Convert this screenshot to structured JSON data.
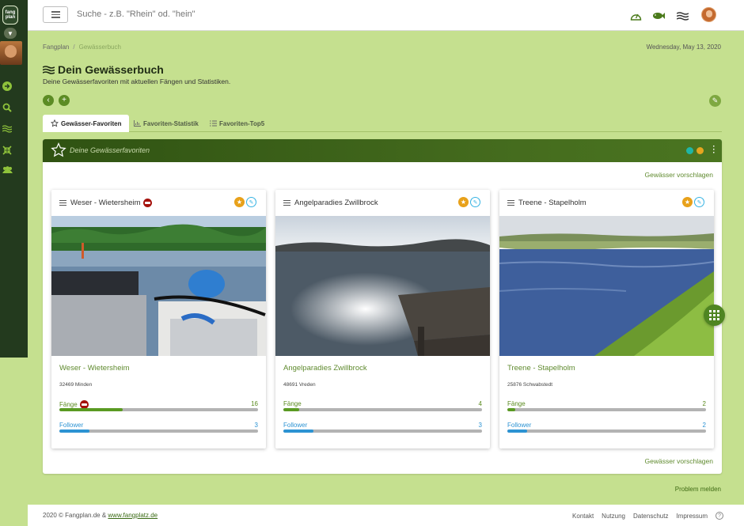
{
  "app": {
    "logo_text": "fang plan"
  },
  "topbar": {
    "search_placeholder": "Suche - z.B. \"Rhein\" od. \"hein\""
  },
  "icons": {
    "sidebar": [
      "chevron-down-icon",
      "arrow-right-icon",
      "search-icon",
      "water-icon",
      "compress-icon",
      "users-icon"
    ],
    "topbar": [
      "speed-icon",
      "fish-icon",
      "water-icon"
    ]
  },
  "breadcrumb": {
    "home": "Fangplan",
    "current": "Gewässerbuch"
  },
  "date": "Wednesday, May 13, 2020",
  "page": {
    "title": "Dein Gewässerbuch",
    "subtitle": "Deine Gewässerfavoriten mit aktuellen Fängen und Statistiken."
  },
  "tabs": [
    {
      "label": "Gewässer-Favoriten",
      "active": true
    },
    {
      "label": "Favoriten-Statistik",
      "active": false
    },
    {
      "label": "Favoriten-Top5",
      "active": false
    }
  ],
  "panel": {
    "title": "Deine Gewässerfavoriten",
    "suggest_label": "Gewässer vorschlagen",
    "dot_colors": [
      "#1fb6a6",
      "#e6a51f"
    ]
  },
  "cards": [
    {
      "name": "Weser - Wietersheim",
      "title": "Weser - Wietersheim",
      "address": "32469 Minden",
      "catches_label": "Fänge",
      "catches": 16,
      "catches_fraction": 0.32,
      "followers_label": "Follower",
      "followers": 3,
      "followers_fraction": 0.15,
      "has_badge": true
    },
    {
      "name": "Angelparadies Zwillbrock",
      "title": "Angelparadies Zwillbrock",
      "address": "48691 Vreden",
      "catches_label": "Fänge",
      "catches": 4,
      "catches_fraction": 0.08,
      "followers_label": "Follower",
      "followers": 3,
      "followers_fraction": 0.15,
      "has_badge": false
    },
    {
      "name": "Treene - Stapelholm",
      "title": "Treene - Stapelholm",
      "address": "25876 Schwabstedt",
      "catches_label": "Fänge",
      "catches": 2,
      "catches_fraction": 0.04,
      "followers_label": "Follower",
      "followers": 2,
      "followers_fraction": 0.1,
      "has_badge": false
    }
  ],
  "problem_label": "Problem melden",
  "footer": {
    "copyright": "2020 © Fangplan.de & ",
    "link": "www.fangplatz.de",
    "links": [
      "Kontakt",
      "Nutzung",
      "Datenschutz",
      "Impressum"
    ]
  },
  "colors": {
    "brand_green": "#5f8a2e",
    "catch_bar": "#5a9a22",
    "follower_bar": "#2c93d3",
    "sidebar": "#233a1e"
  }
}
